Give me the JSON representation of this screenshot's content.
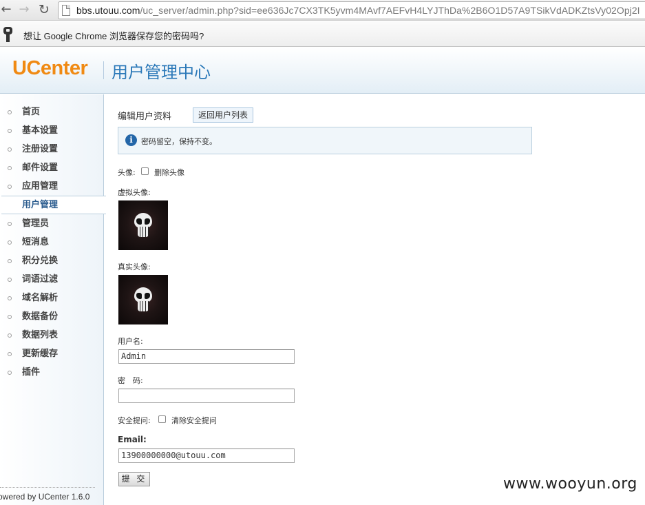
{
  "browser": {
    "url_host": "bbs.utouu.com",
    "url_path": "/uc_server/admin.php?sid=ee636Jc7CX3TK5yvm4MAvf7AEFvH4LYJThDa%2B6O1D57A9TSikVdADKZtsVy02Opj2I",
    "password_prompt": "想让 Google Chrome 浏览器保存您的密码吗?"
  },
  "header": {
    "logo": "UCenter",
    "title": "用户管理中心"
  },
  "sidebar": {
    "items": [
      {
        "label": "首页"
      },
      {
        "label": "基本设置"
      },
      {
        "label": "注册设置"
      },
      {
        "label": "邮件设置"
      },
      {
        "label": "应用管理"
      },
      {
        "label": "用户管理",
        "active": true
      },
      {
        "label": "管理员"
      },
      {
        "label": "短消息"
      },
      {
        "label": "积分兑换"
      },
      {
        "label": "词语过滤"
      },
      {
        "label": "域名解析"
      },
      {
        "label": "数据备份"
      },
      {
        "label": "数据列表"
      },
      {
        "label": "更新缓存"
      },
      {
        "label": "插件"
      }
    ],
    "powered": "owered by UCenter 1.6.0"
  },
  "main": {
    "title": "编辑用户资料",
    "back_button": "返回用户列表",
    "notice": "密码留空，保持不变。",
    "avatar_label": "头像:",
    "delete_avatar_label": "删除头像",
    "virtual_avatar_label": "虚拟头像:",
    "real_avatar_label": "真实头像:",
    "username_label": "用户名:",
    "username_value": "Admin",
    "password_label": "密　码:",
    "password_value": "",
    "security_label": "安全提问:",
    "clear_security_label": "清除安全提问",
    "email_label": "Email:",
    "email_value": "13900000000@utouu.com",
    "submit_label": "提 交"
  },
  "watermark": "www.wooyun.org"
}
